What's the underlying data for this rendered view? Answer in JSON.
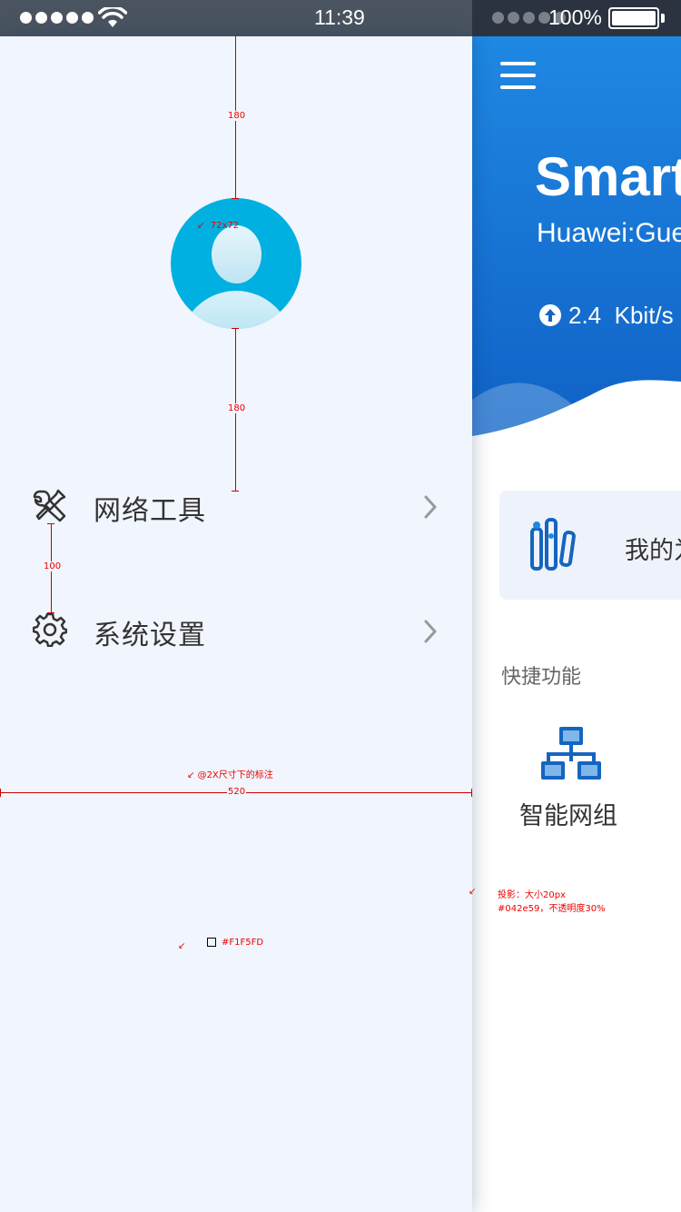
{
  "status_bar": {
    "time": "11:39",
    "battery_text": "100%"
  },
  "main": {
    "title": "Smart",
    "subtitle": "Huawei:Gue",
    "speed_value": "2.4",
    "speed_unit": "Kbit/s",
    "card_text": "我的为",
    "quick_section_title": "快捷功能",
    "quick_items": [
      {
        "label": "智能网组",
        "icon": "network-topology-icon"
      }
    ]
  },
  "drawer": {
    "menu": [
      {
        "label": "网络工具",
        "icon": "tools-icon"
      },
      {
        "label": "系统设置",
        "icon": "gear-icon"
      }
    ]
  },
  "annotations": {
    "top_gap": "180",
    "avatar_size": "72x72",
    "bottom_gap": "180",
    "item_gap": "100",
    "scale_note": "@2X尺寸下的标注",
    "drawer_width": "520",
    "shadow_note_1": "投影：大小20px",
    "shadow_note_2": "#042e59，不透明度30%",
    "bg_color": "#F1F5FD"
  },
  "colors": {
    "drawer_bg": "#F1F5FD",
    "header_blue": "#1f88e3",
    "accent": "#1565c0",
    "shadow": "#042e59"
  }
}
